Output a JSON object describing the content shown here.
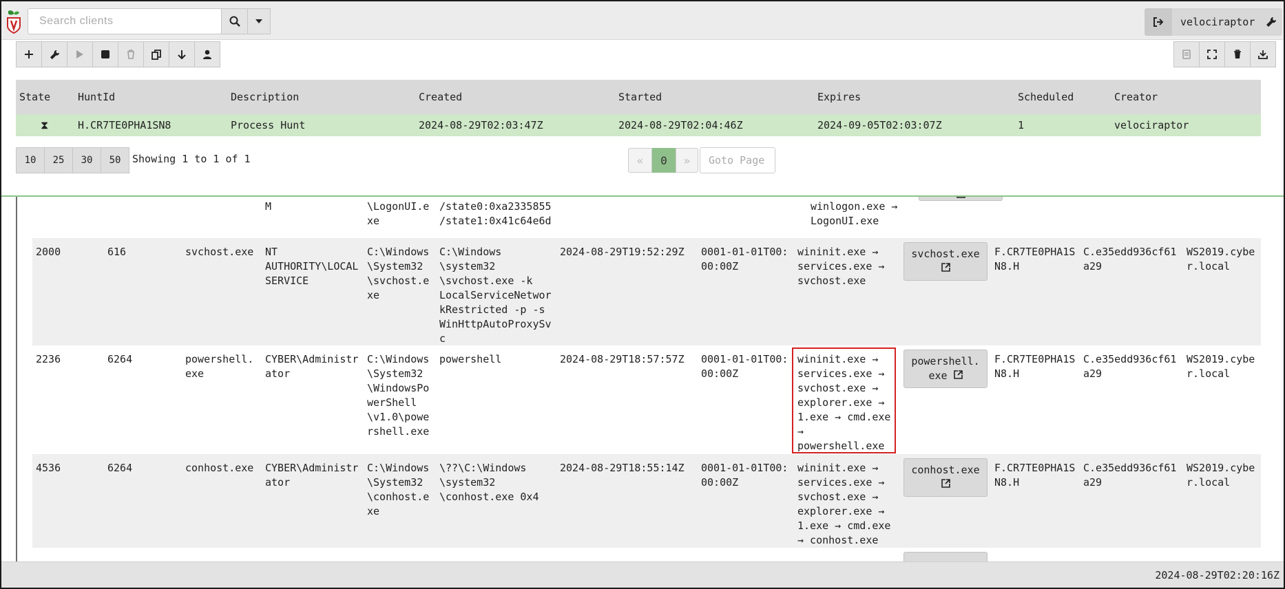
{
  "topbar": {
    "search_placeholder": "Search clients",
    "username": "velociraptor"
  },
  "icons": {
    "search": "search-icon",
    "dropdown": "caret-down-icon",
    "logout": "logout-icon",
    "settings": "wrench-icon",
    "add": "plus-icon",
    "edit": "wrench-icon",
    "run": "play-icon",
    "stop": "stop-icon",
    "delete": "trash-icon",
    "copy": "copy-icon",
    "download": "arrow-down-icon",
    "user": "user-icon",
    "notebook": "notebook-icon",
    "fullscreen": "fullscreen-icon",
    "external": "external-link-icon"
  },
  "hunts_table": {
    "headers": [
      "State",
      "HuntId",
      "Description",
      "Created",
      "Started",
      "Expires",
      "Scheduled",
      "Creator"
    ],
    "row": {
      "state": "⧗",
      "hunt_id": "H.CR7TE0PHA1SN8",
      "description": "Process Hunt",
      "created": "2024-08-29T02:03:47Z",
      "started": "2024-08-29T02:04:46Z",
      "expires": "2024-09-05T02:03:07Z",
      "scheduled": "1",
      "creator": "velociraptor"
    }
  },
  "pagination": {
    "page_sizes": [
      "10",
      "25",
      "30",
      "50"
    ],
    "showing": "Showing 1 to 1 of 1",
    "prev": "«",
    "current": "0",
    "next": "»",
    "goto_placeholder": "Goto Page"
  },
  "results": {
    "top_partial": {
      "c3": "M",
      "c4": "\\LogonUI.e\nxe",
      "c5": "/state0:0xa2335855\n/state1:0x41c64e6d",
      "c8": "svchost.exe →\nwinlogon.exe →\nLogonUI.exe"
    },
    "rows": [
      {
        "pid": "2000",
        "ppid": "616",
        "name": "svchost.exe",
        "user": "NT\nAUTHORITY\\LOCAL\nSERVICE",
        "path": "C:\\Windows\n\\System32\n\\svchost.e\nxe",
        "cmdline": "C:\\Windows\n\\system32\n\\svchost.exe -k\nLocalServiceNetwor\nkRestricted -p -s\nWinHttpAutoProxySv\nc",
        "create_time": "2024-08-29T19:52:29Z",
        "exit_time": "0001-01-01T00:\n00:00Z",
        "call_chain": "wininit.exe →\nservices.exe →\nsvchost.exe",
        "button": "svchost.exe",
        "flow": "F.CR7TE0PHA1S\nN8.H",
        "client": "C.e35edd936cf61\na29",
        "host": "WS2019.cybe\nr.local"
      },
      {
        "pid": "2236",
        "ppid": "6264",
        "name": "powershell.\nexe",
        "user": "CYBER\\Administr\nator",
        "path": "C:\\Windows\n\\System32\n\\WindowsPo\nwerShell\n\\v1.0\\powe\nrshell.exe",
        "cmdline": "powershell",
        "create_time": "2024-08-29T18:57:57Z",
        "exit_time": "0001-01-01T00:\n00:00Z",
        "call_chain": "wininit.exe →\nservices.exe →\nsvchost.exe →\nexplorer.exe →\n1.exe → cmd.exe\n→\npowershell.exe",
        "button": "powershell.\nexe",
        "flow": "F.CR7TE0PHA1S\nN8.H",
        "client": "C.e35edd936cf61\na29",
        "host": "WS2019.cybe\nr.local"
      },
      {
        "pid": "4536",
        "ppid": "6264",
        "name": "conhost.exe",
        "user": "CYBER\\Administr\nator",
        "path": "C:\\Windows\n\\System32\n\\conhost.e\nxe",
        "cmdline": "\\??\\C:\\Windows\n\\system32\n\\conhost.exe 0x4",
        "create_time": "2024-08-29T18:55:14Z",
        "exit_time": "0001-01-01T00:\n00:00Z",
        "call_chain": "wininit.exe →\nservices.exe →\nsvchost.exe →\nexplorer.exe →\n1.exe → cmd.exe\n→ conhost.exe",
        "button": "conhost.exe",
        "flow": "F.CR7TE0PHA1S\nN8.H",
        "client": "C.e35edd936cf61\na29",
        "host": "WS2019.cybe\nr.local"
      }
    ]
  },
  "footer": {
    "timestamp": "2024-08-29T02:20:16Z"
  }
}
